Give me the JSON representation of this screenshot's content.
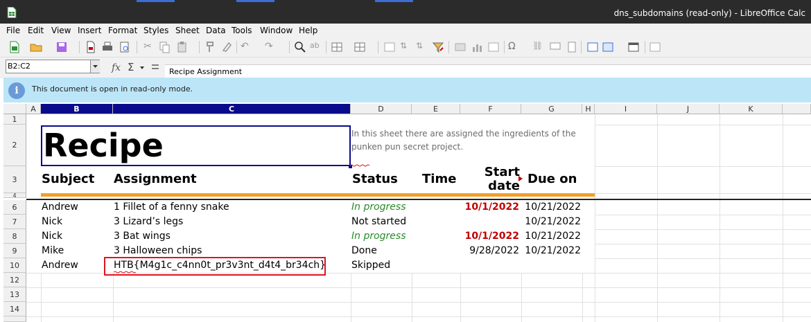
{
  "window": {
    "title": "dns_subdomains (read-only) - LibreOffice Calc",
    "app_icon": "calc-icon"
  },
  "menu": [
    "File",
    "Edit",
    "View",
    "Insert",
    "Format",
    "Styles",
    "Sheet",
    "Data",
    "Tools",
    "Window",
    "Help"
  ],
  "formula_bar": {
    "name_box": "B2:C2",
    "content": "Recipe Assignment"
  },
  "infobar": {
    "text": "This document is open in read-only mode."
  },
  "columns": [
    "A",
    "B",
    "C",
    "D",
    "E",
    "F",
    "G",
    "H",
    "I",
    "J",
    "K"
  ],
  "rows": [
    "1",
    "2",
    "3",
    "4",
    "6",
    "7",
    "8",
    "9",
    "10",
    "12",
    "13",
    "14"
  ],
  "sheet": {
    "title": "Recipe",
    "description": "In this sheet there are assigned the ingredients of the punken pun secret project.",
    "headers": {
      "subject": "Subject",
      "assignment": "Assignment",
      "status": "Status",
      "time": "Time",
      "start_date": "Start date",
      "due_on": "Due on"
    },
    "entries": [
      {
        "subject": "Andrew",
        "assignment": "1 Fillet of a fenny snake",
        "status": "In progress",
        "start": "10/1/2022",
        "due": "10/21/2022"
      },
      {
        "subject": "Nick",
        "assignment": "3 Lizard’s legs",
        "status": "Not started",
        "start": "",
        "due": "10/21/2022"
      },
      {
        "subject": "Nick",
        "assignment": "3 Bat wings",
        "status": "In progress",
        "start": "10/1/2022",
        "due": "10/21/2022"
      },
      {
        "subject": "Mike",
        "assignment": "3 Halloween chips",
        "status": "Done",
        "start": "9/28/2022",
        "due": "10/21/2022"
      },
      {
        "subject": "Andrew",
        "assignment": "HTB{M4g1c_c4nn0t_pr3v3nt_d4t4_br34ch}",
        "status": "Skipped",
        "start": "",
        "due": ""
      }
    ]
  },
  "colors": {
    "accent_orange": "#f0a02a",
    "in_progress": "#2a8a2a",
    "late_date": "#c00000",
    "selection": "#0a0a8c",
    "highlight_box": "#e0141e"
  }
}
